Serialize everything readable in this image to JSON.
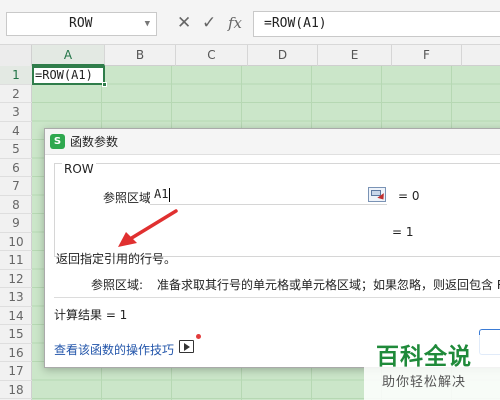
{
  "formula_bar": {
    "name_box": "ROW",
    "cancel_icon": "close-icon",
    "enter_icon": "check-icon",
    "fx_label": "fx",
    "formula": "=ROW(A1)"
  },
  "sheet": {
    "columns": [
      "A",
      "B",
      "C",
      "D",
      "E",
      "F"
    ],
    "rows": [
      "1",
      "2",
      "3",
      "4",
      "5",
      "6",
      "7",
      "8",
      "9",
      "10",
      "11",
      "12",
      "13",
      "14",
      "15",
      "16",
      "17",
      "18"
    ],
    "active_cell_text": "=ROW(A1)"
  },
  "dialog": {
    "title": "函数参数",
    "function_name": "ROW",
    "param_label": "参照区域",
    "param_value": "A1",
    "param_result": "= 0",
    "function_result": "= 1",
    "description": "返回指定引用的行号。",
    "param_desc_label": "参照区域:",
    "param_desc_text": "准备求取其行号的单元格或单元格区域；如果忽略，则返回包含 R",
    "calc_result": "计算结果 = 1",
    "help_link": "查看该函数的操作技巧"
  },
  "watermark": {
    "title": "百科全说",
    "subtitle": "助你轻松解决"
  },
  "colors": {
    "accent_green": "#217346",
    "grid_fill": "#cbe6c9",
    "link_blue": "#2255aa",
    "annotation_red": "#e03030"
  }
}
